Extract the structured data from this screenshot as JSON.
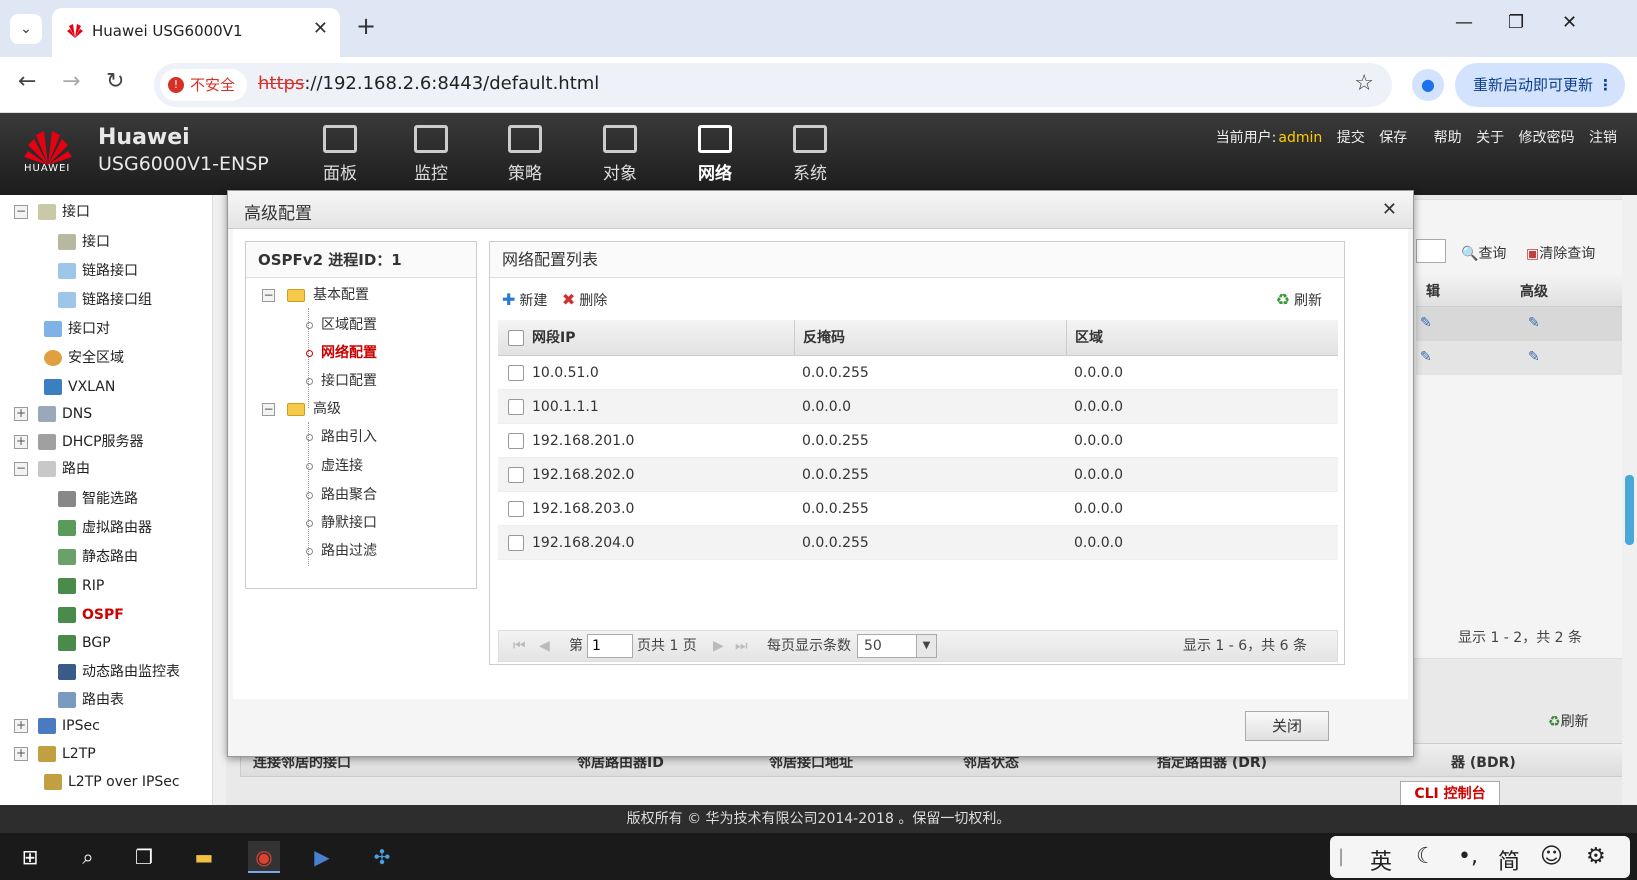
{
  "browser": {
    "tab_title": "Huawei USG6000V1",
    "insecure_label": "不安全",
    "url_scheme": "https",
    "url_rest": "://192.168.2.6:8443/default.html",
    "restart_label": "重新启动即可更新"
  },
  "header": {
    "logo_text": "HUAWEI",
    "brand_line1": "Huawei",
    "brand_line2": "USG6000V1-ENSP",
    "menu": [
      {
        "label": "面板"
      },
      {
        "label": "监控"
      },
      {
        "label": "策略"
      },
      {
        "label": "对象"
      },
      {
        "label": "网络"
      },
      {
        "label": "系统"
      }
    ],
    "current_user_label": "当前用户:",
    "current_user": "admin",
    "links": [
      "提交",
      "保存",
      "帮助",
      "关于",
      "修改密码",
      "注销"
    ]
  },
  "sidebar": {
    "items": [
      {
        "label": "接口"
      },
      {
        "label": "接口"
      },
      {
        "label": "链路接口"
      },
      {
        "label": "链路接口组"
      },
      {
        "label": "接口对"
      },
      {
        "label": "安全区域"
      },
      {
        "label": "VXLAN"
      },
      {
        "label": "DNS"
      },
      {
        "label": "DHCP服务器"
      },
      {
        "label": "路由"
      },
      {
        "label": "智能选路"
      },
      {
        "label": "虚拟路由器"
      },
      {
        "label": "静态路由"
      },
      {
        "label": "RIP"
      },
      {
        "label": "OSPF"
      },
      {
        "label": "BGP"
      },
      {
        "label": "动态路由监控表"
      },
      {
        "label": "路由表"
      },
      {
        "label": "IPSec"
      },
      {
        "label": "L2TP"
      },
      {
        "label": "L2TP over IPSec"
      }
    ]
  },
  "background": {
    "query_label": "查询",
    "clear_query_label": "清除查询",
    "col_edit": "辑",
    "col_advanced": "高级",
    "summary_top": "显示 1 - 2，共 2 条",
    "refresh_label": "刷新",
    "neighbor_headers": [
      "连接邻居的接口",
      "邻居路由器ID",
      "邻居接口地址",
      "邻居状态",
      "指定路由器 (DR)",
      "器 (BDR)"
    ],
    "cli_label": "CLI 控制台",
    "footer": "版权所有 © 华为技术有限公司2014-2018 。保留一切权利。"
  },
  "modal": {
    "title": "高级配置",
    "tree_title": "OSPFv2 进程ID：1",
    "tree": {
      "basic": "基本配置",
      "area": "区域配置",
      "network": "网络配置",
      "interface": "接口配置",
      "advanced": "高级",
      "import": "路由引入",
      "vlink": "虚连接",
      "aggregate": "路由聚合",
      "silent": "静默接口",
      "filter": "路由过滤"
    },
    "list_title": "网络配置列表",
    "new_label": "新建",
    "delete_label": "删除",
    "refresh_label": "刷新",
    "columns": [
      "网段IP",
      "反掩码",
      "区域"
    ],
    "rows": [
      {
        "ip": "10.0.51.0",
        "mask": "0.0.0.255",
        "area": "0.0.0.0"
      },
      {
        "ip": "100.1.1.1",
        "mask": "0.0.0.0",
        "area": "0.0.0.0"
      },
      {
        "ip": "192.168.201.0",
        "mask": "0.0.0.255",
        "area": "0.0.0.0"
      },
      {
        "ip": "192.168.202.0",
        "mask": "0.0.0.255",
        "area": "0.0.0.0"
      },
      {
        "ip": "192.168.203.0",
        "mask": "0.0.0.255",
        "area": "0.0.0.0"
      },
      {
        "ip": "192.168.204.0",
        "mask": "0.0.0.255",
        "area": "0.0.0.0"
      }
    ],
    "pager": {
      "page_prefix": "第",
      "page_value": "1",
      "page_suffix": "页共 1 页",
      "per_page_label": "每页显示条数",
      "per_page_value": "50",
      "summary": "显示 1 - 6，共 6 条"
    },
    "close_label": "关闭"
  },
  "taskbar": {
    "ime": [
      "英",
      "简"
    ]
  }
}
